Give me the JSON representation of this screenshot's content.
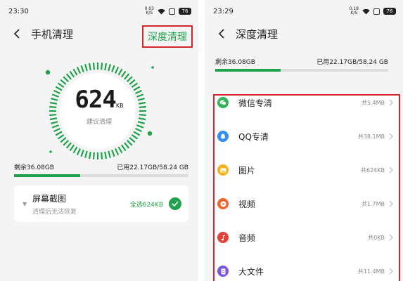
{
  "left": {
    "status": {
      "time": "23:30",
      "net_speed_value": "0.03",
      "net_speed_unit": "K/S",
      "battery": "76"
    },
    "header": {
      "title": "手机清理",
      "action_label": "深度清理"
    },
    "ring": {
      "size_value": "624",
      "size_unit": "KB",
      "caption": "建议清理"
    },
    "storage": {
      "remaining": "剩余36.08GB",
      "used": "已用22.17GB/58.24 GB",
      "used_fraction": 0.38
    },
    "card": {
      "title": "屏幕截图",
      "subtitle": "清理后无法恢复",
      "select_label": "全选624KB"
    }
  },
  "right": {
    "status": {
      "time": "23:29",
      "net_speed_value": "0.18",
      "net_speed_unit": "K/S",
      "battery": "76"
    },
    "header": {
      "title": "深度清理"
    },
    "storage": {
      "remaining": "剩余36.08GB",
      "used": "已用22.17GB/58.24 GB",
      "used_fraction": 0.38
    },
    "categories": [
      {
        "label": "微信专清",
        "size": "共5.4MB",
        "color": "#2db553",
        "icon": "wechat-icon"
      },
      {
        "label": "QQ专清",
        "size": "共38.1MB",
        "color": "#2f8ef0",
        "icon": "qq-icon"
      },
      {
        "label": "图片",
        "size": "共624KB",
        "color": "#f5b21b",
        "icon": "image-icon"
      },
      {
        "label": "视频",
        "size": "共1.7MB",
        "color": "#f0632a",
        "icon": "video-icon"
      },
      {
        "label": "音频",
        "size": "共0KB",
        "color": "#e23f3a",
        "icon": "music-icon"
      },
      {
        "label": "大文件",
        "size": "共11.4MB",
        "color": "#7a55e0",
        "icon": "file-icon"
      }
    ]
  },
  "colors": {
    "accent_green": "#1fa24b",
    "highlight_red": "#d2262b"
  }
}
